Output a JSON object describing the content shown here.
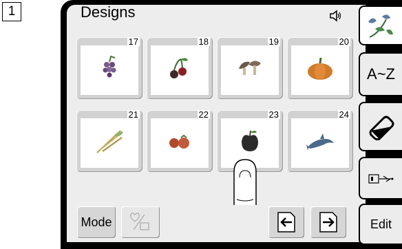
{
  "step_number": "1",
  "screen": {
    "title": "Designs"
  },
  "designs": [
    {
      "number": "17",
      "icon": "grapes-icon"
    },
    {
      "number": "18",
      "icon": "cherries-icon"
    },
    {
      "number": "19",
      "icon": "mushrooms-icon"
    },
    {
      "number": "20",
      "icon": "pumpkin-icon"
    },
    {
      "number": "21",
      "icon": "wheat-icon"
    },
    {
      "number": "22",
      "icon": "tomatoes-icon"
    },
    {
      "number": "23",
      "icon": "apple-icon"
    },
    {
      "number": "24",
      "icon": "dolphin-icon"
    }
  ],
  "toolbar": {
    "mode_label": "Mode"
  },
  "tabs": {
    "az_label": "A~Z",
    "edit_label": "Edit"
  },
  "colors": {
    "screen_bg": "#ededed",
    "button_bg": "#d6d6d6",
    "bezel": "#000000"
  }
}
